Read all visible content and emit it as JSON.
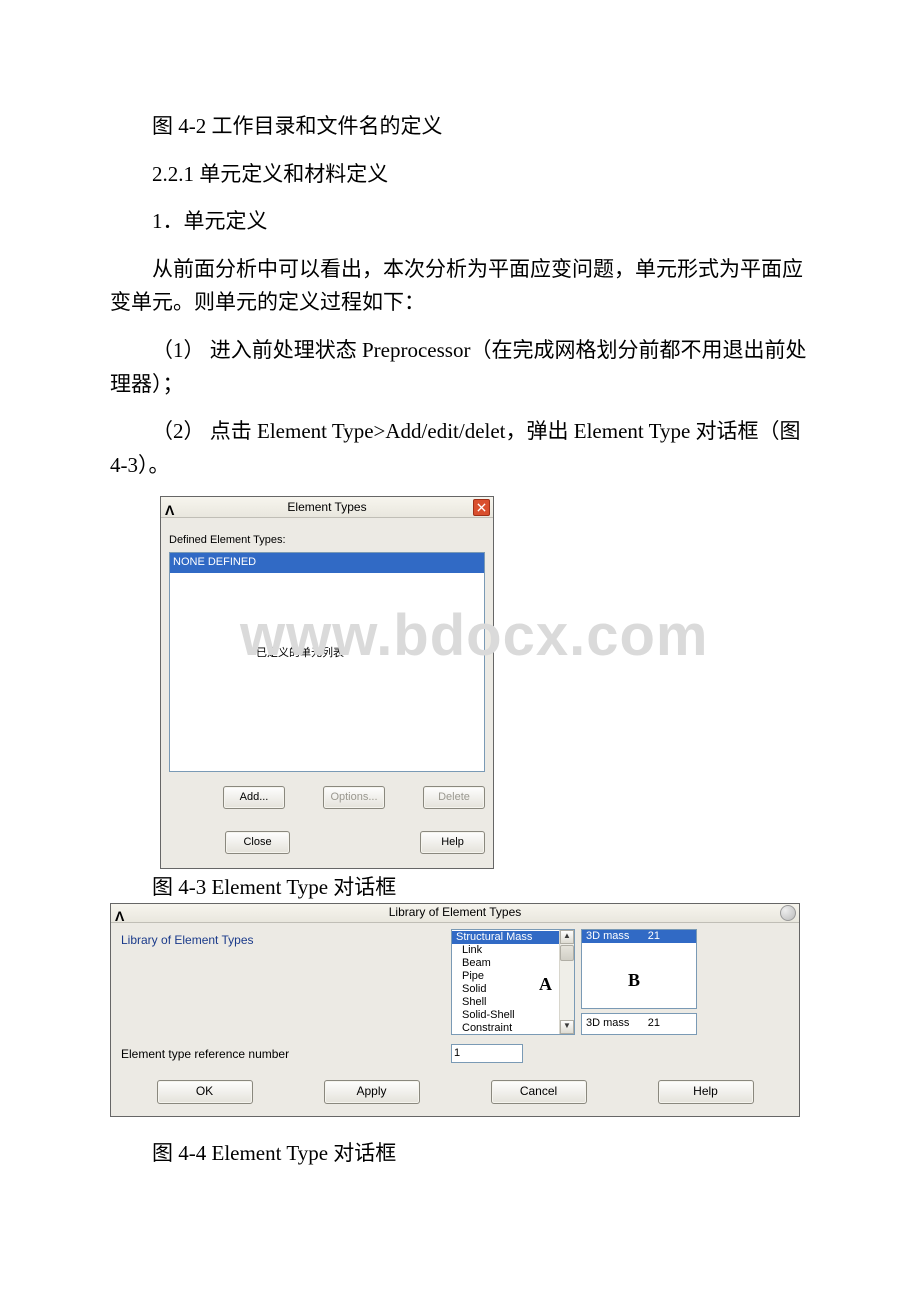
{
  "paragraphs": {
    "p1": "图 4-2 工作目录和文件名的定义",
    "p2": "2.2.1 单元定义和材料定义",
    "p3": "1．单元定义",
    "p4": "从前面分析中可以看出，本次分析为平面应变问题，单元形式为平面应变单元。则单元的定义过程如下：",
    "p5": "（1） 进入前处理状态 Preprocessor（在完成网格划分前都不用退出前处理器）；",
    "p6": "（2） 点击 Element Type>Add/edit/delet，弹出 Element Type 对话框（图 4-3）。",
    "cap1": "图 4-3 Element Type 对话框",
    "cap2": "图 4-4 Element Type 对话框"
  },
  "watermark": "www.bdocx.com",
  "dialog1": {
    "title": "Element Types",
    "defined_label": "Defined Element Types:",
    "selected_item": "NONE DEFINED",
    "annotation": "已定义的单元列表",
    "buttons": {
      "add": "Add...",
      "options": "Options...",
      "delete": "Delete",
      "close": "Close",
      "help": "Help"
    }
  },
  "dialog2": {
    "title": "Library of Element Types",
    "row1_label": "Library of Element Types",
    "listA": [
      "Structural Mass",
      "Link",
      "Beam",
      "Pipe",
      "Solid",
      "Shell",
      "Solid-Shell",
      "Constraint"
    ],
    "listB_selected": "3D mass      21",
    "listB_display": "3D mass      21",
    "letterA": "A",
    "letterB": "B",
    "row2_label": "Element type reference number",
    "ref_value": "1",
    "buttons": {
      "ok": "OK",
      "apply": "Apply",
      "cancel": "Cancel",
      "help": "Help"
    }
  }
}
